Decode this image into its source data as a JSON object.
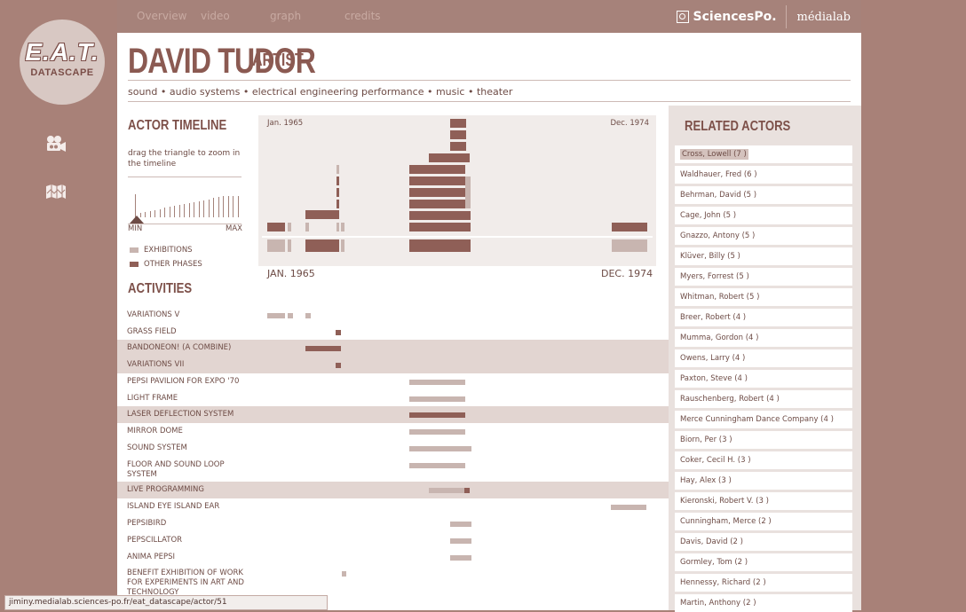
{
  "nav": [
    "Overview",
    "video",
    "graph",
    "credits"
  ],
  "brand": {
    "sciencespo": "SciencesPo.",
    "medialab": "médialab"
  },
  "logo": {
    "main": "E.A.T.",
    "sub": "DATASCAPE"
  },
  "actor": {
    "name": "DAVID TUDOR",
    "role": "ARTIST",
    "tags": "sound • audio systems • electrical engineering performance • music • theater"
  },
  "timeline": {
    "title": "ACTOR TIMELINE",
    "hint": "drag the triangle to zoom in the timeline",
    "min": "MIN",
    "max": "MAX",
    "legend_exhibitions": "EXHIBITIONS",
    "legend_other": "OTHER PHASES",
    "start_small": "Jan. 1965",
    "end_small": "Dec. 1974",
    "start_big": "JAN. 1965",
    "end_big": "DEC. 1974"
  },
  "activities_title": "ACTIVITIES",
  "activities": [
    {
      "label": "VARIATIONS V",
      "hl": false
    },
    {
      "label": "GRASS FIELD",
      "hl": false
    },
    {
      "label": "BANDONEON! (A COMBINE)",
      "hl": true
    },
    {
      "label": "VARIATIONS VII",
      "hl": true
    },
    {
      "label": "PEPSI PAVILION FOR EXPO '70",
      "hl": false
    },
    {
      "label": "LIGHT FRAME",
      "hl": false
    },
    {
      "label": "LASER DEFLECTION SYSTEM",
      "hl": true
    },
    {
      "label": "MIRROR DOME",
      "hl": false
    },
    {
      "label": "SOUND SYSTEM",
      "hl": false
    },
    {
      "label": "FLOOR AND SOUND LOOP SYSTEM",
      "hl": false
    },
    {
      "label": "LIVE PROGRAMMING",
      "hl": true
    },
    {
      "label": "ISLAND EYE ISLAND EAR",
      "hl": false
    },
    {
      "label": "PEPSIBIRD",
      "hl": false
    },
    {
      "label": "PEPSCILLATOR",
      "hl": false
    },
    {
      "label": "ANIMA PEPSI",
      "hl": false
    },
    {
      "label": "BENEFIT EXHIBITION OF WORK FOR EXPERIMENTS IN ART AND TECHNOLOGY",
      "hl": false
    }
  ],
  "related_title": "RELATED ACTORS",
  "related": [
    "Cross, Lowell (7 )",
    "Waldhauer, Fred (6 )",
    "Behrman, David (5 )",
    "Cage, John (5 )",
    "Gnazzo, Antony (5 )",
    "Klüver, Billy (5 )",
    "Myers, Forrest (5 )",
    "Whitman, Robert (5 )",
    "Breer, Robert (4 )",
    "Mumma, Gordon (4 )",
    "Owens, Larry (4 )",
    "Paxton, Steve (4 )",
    "Rauschenberg, Robert (4 )",
    "Merce Cunningham Dance Company (4 )",
    "Biorn, Per (3 )",
    "Coker, Cecil H. (3 )",
    "Hay, Alex (3 )",
    "Kieronski, Robert V. (3 )",
    "Cunningham, Merce (2 )",
    "Davis, David (2 )",
    "Gormley, Tom (2 )",
    "Hennessy, Richard (2 )",
    "Martin, Anthony (2 )"
  ],
  "status_url": "jiminy.medialab.sciences-po.fr/eat_datascape/actor/51",
  "colors": {
    "exhibition": "#c8b5b0",
    "other": "#8f5f57",
    "highlight": "#e2d5d1"
  }
}
